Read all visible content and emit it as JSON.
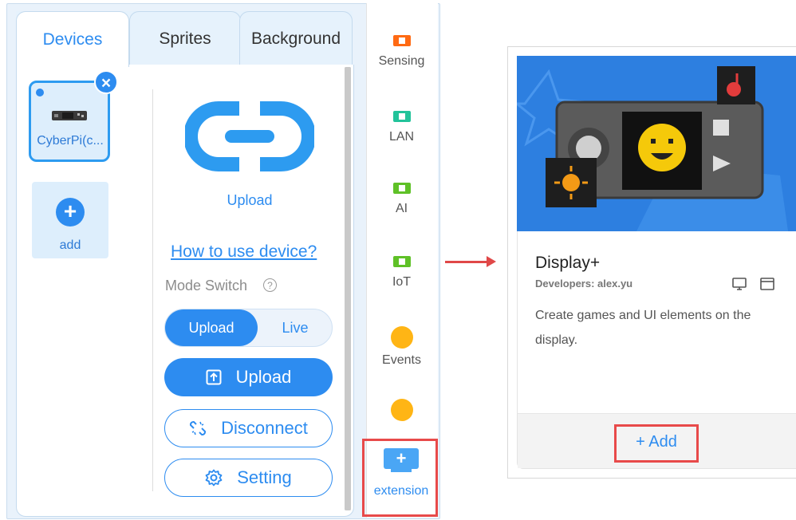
{
  "tabs": [
    "Devices",
    "Sprites",
    "Background"
  ],
  "device": {
    "name": "CyberPi(c..."
  },
  "add_device": {
    "label": "add"
  },
  "upload": {
    "caption": "Upload",
    "help_link": "How to use device?",
    "mode_label": "Mode Switch",
    "help_glyph": "?",
    "mode_options": [
      "Upload",
      "Live"
    ],
    "upload_button": "Upload",
    "disconnect_button": "Disconnect",
    "setting_button": "Setting"
  },
  "categories": [
    {
      "label": "Sensing",
      "icon": "sensing-icon",
      "color": "#ff6a13"
    },
    {
      "label": "LAN",
      "icon": "lan-icon",
      "color": "#22c39a"
    },
    {
      "label": "AI",
      "icon": "ai-icon",
      "color": "#5fc127"
    },
    {
      "label": "IoT",
      "icon": "iot-icon",
      "color": "#5fc127"
    },
    {
      "label": "Events",
      "icon": "events-icon",
      "color": "#ffb515"
    }
  ],
  "extension_button": {
    "label": "extension",
    "glyph": "+"
  },
  "extension_card": {
    "title": "Display+",
    "developer": "Developers: alex.yu",
    "description": "Create games and UI elements on the display.",
    "add_label": "+ Add"
  },
  "colors": {
    "accent": "#2d8cf0",
    "highlight": "#e84a4a"
  }
}
